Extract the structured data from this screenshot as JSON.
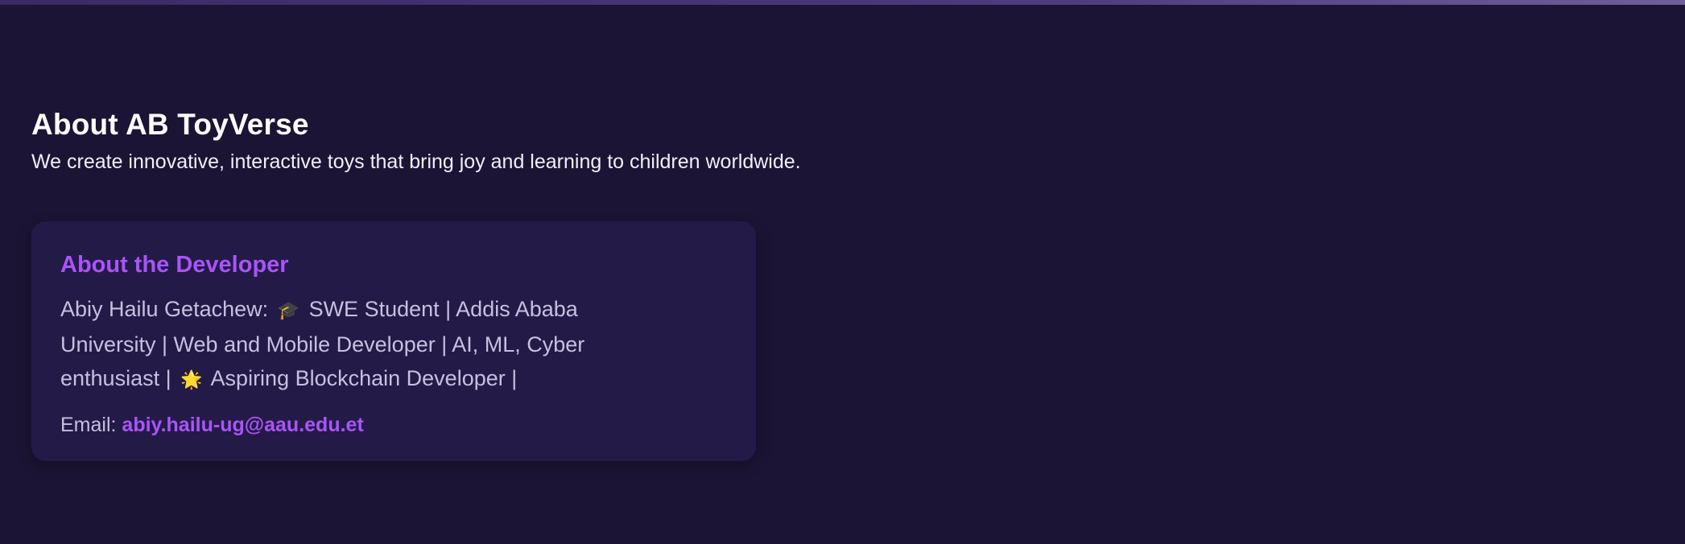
{
  "about": {
    "title": "About AB ToyVerse",
    "tagline": "We create innovative, interactive toys that bring joy and learning to children worldwide."
  },
  "developer": {
    "heading": "About the Developer",
    "bio_name": "Abiy Hailu Getachew:",
    "emoji_grad": "🎓",
    "bio_part1": "SWE Student | Addis Ababa University | Web and Mobile Developer | AI, ML, Cyber enthusiast |",
    "emoji_sun": "🌟",
    "bio_part2": "Aspiring Blockchain Developer |",
    "email_label": "Email:",
    "email": "abiy.hailu-ug@aau.edu.et"
  },
  "colors": {
    "background": "#1b1434",
    "card": "#241a48",
    "accent": "#a855f7"
  }
}
